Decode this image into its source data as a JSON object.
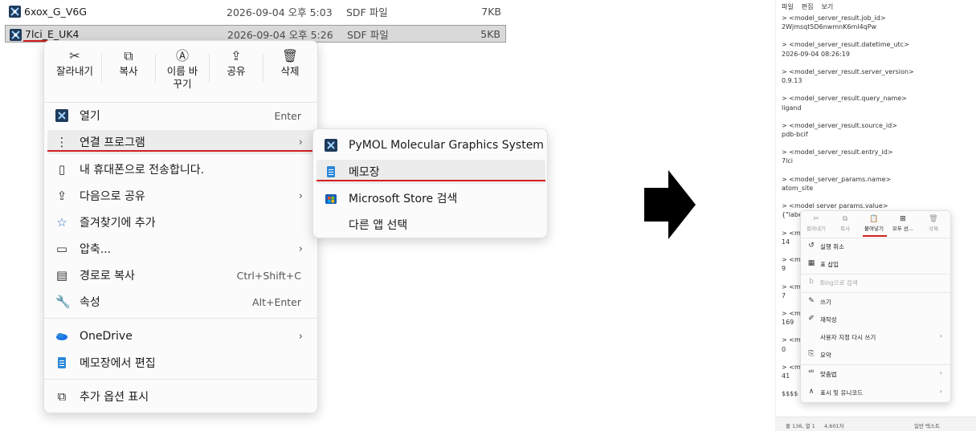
{
  "explorer": {
    "files": [
      {
        "name": "6xox_G_V6G",
        "date": "2026-09-04 오후 5:03",
        "type": "SDF 파일",
        "size": "7KB"
      },
      {
        "name": "7lci_E_UK4",
        "date": "2026-09-04 오후 5:26",
        "type": "SDF 파일",
        "size": "5KB"
      }
    ]
  },
  "context_menu": {
    "quick_actions": [
      {
        "icon": "scissors-icon",
        "label": "잘라내기"
      },
      {
        "icon": "copy-icon",
        "label": "복사"
      },
      {
        "icon": "rename-icon",
        "label": "이름 바꾸기"
      },
      {
        "icon": "share-icon",
        "label": "공유"
      },
      {
        "icon": "trash-icon",
        "label": "삭제"
      }
    ],
    "items": [
      {
        "icon": "pymol-icon",
        "label": "열기",
        "accel": "Enter"
      },
      {
        "icon": "open-with-icon",
        "label": "연결 프로그램",
        "has_submenu": true
      },
      {
        "icon": "phone-icon",
        "label": "내 휴대폰으로 전송합니다."
      },
      {
        "icon": "share-icon",
        "label": "다음으로 공유",
        "has_submenu": true
      },
      {
        "icon": "star-icon",
        "label": "즐겨찾기에 추가"
      },
      {
        "icon": "zip-icon",
        "label": "압축...",
        "has_submenu": true
      },
      {
        "icon": "copy-path-icon",
        "label": "경로로 복사",
        "accel": "Ctrl+Shift+C"
      },
      {
        "icon": "properties-icon",
        "label": "속성",
        "accel": "Alt+Enter"
      },
      {
        "icon": "onedrive-icon",
        "label": "OneDrive",
        "has_submenu": true
      },
      {
        "icon": "notepad-icon",
        "label": "메모장에서 편집"
      },
      {
        "icon": "more-options-icon",
        "label": "추가 옵션 표시"
      }
    ]
  },
  "submenu": {
    "items": [
      {
        "icon": "pymol-icon",
        "label": "PyMOL Molecular Graphics System"
      },
      {
        "icon": "notepad-icon",
        "label": "메모장"
      },
      {
        "icon": "store-icon",
        "label": "Microsoft Store 검색"
      },
      {
        "icon": "",
        "label": "다른 앱 선택"
      }
    ]
  },
  "notepad": {
    "menu": [
      "파일",
      "편집",
      "보기"
    ],
    "lines": [
      "> <model_server_result.job_id>",
      "2Wjmsqt5D6nwmnK6ml4qPw",
      "",
      "> <model_server_result.datetime_utc>",
      "2026-09-04 08:26:19",
      "",
      "> <model_server_result.server_version>",
      "0.9.13",
      "",
      "> <model_server_result.query_name>",
      "ligand",
      "",
      "> <model_server_result.source_id>",
      "pdb-bcif",
      "",
      "> <model_server_result.entry_id>",
      "7lci",
      "",
      "> <model_server_params.name>",
      "atom_site",
      "",
      "> <model server params.value>",
      "{\"labe",
      "",
      "> <m",
      "14",
      "",
      "> <m",
      "9",
      "",
      "> <m",
      "7",
      "",
      "> <m",
      "169",
      "",
      "> <m",
      "0",
      "",
      "> <m",
      "41",
      "",
      "$$$$"
    ],
    "status": {
      "position": "줄 136, 열 1",
      "chars": "4,601자",
      "format": "일반 텍스트"
    },
    "context_menu": {
      "quick_actions": [
        {
          "icon": "scissors-icon",
          "label": "잘라내기",
          "enabled": false
        },
        {
          "icon": "copy-icon",
          "label": "복사",
          "enabled": false
        },
        {
          "icon": "paste-icon",
          "label": "붙여넣기",
          "enabled": true
        },
        {
          "icon": "select-all-icon",
          "label": "모두 선...",
          "enabled": true
        },
        {
          "icon": "trash-icon",
          "label": "삭제",
          "enabled": false
        }
      ],
      "items": [
        {
          "icon": "undo-icon",
          "label": "실행 취소"
        },
        {
          "icon": "table-icon",
          "label": "표 삽입"
        },
        {
          "icon": "bing-icon",
          "label": "Bing으로 검색",
          "disabled": true
        },
        {
          "icon": "write-icon",
          "label": "쓰기"
        },
        {
          "icon": "rewrite-icon",
          "label": "재작성"
        },
        {
          "icon": "",
          "label": "사용자 지정 다시 쓰기",
          "has_submenu": true
        },
        {
          "icon": "summary-icon",
          "label": "요약"
        },
        {
          "icon": "spellcheck-icon",
          "label": "맞춤법",
          "has_submenu": true
        },
        {
          "icon": "unicode-icon",
          "label": "표시 및 유니코드",
          "has_submenu": true
        }
      ]
    }
  },
  "colors": {
    "annotation_red": "#d31f1f",
    "file_icon_bg": "#1f3b5c",
    "selected_bg": "#d9d9d9"
  }
}
